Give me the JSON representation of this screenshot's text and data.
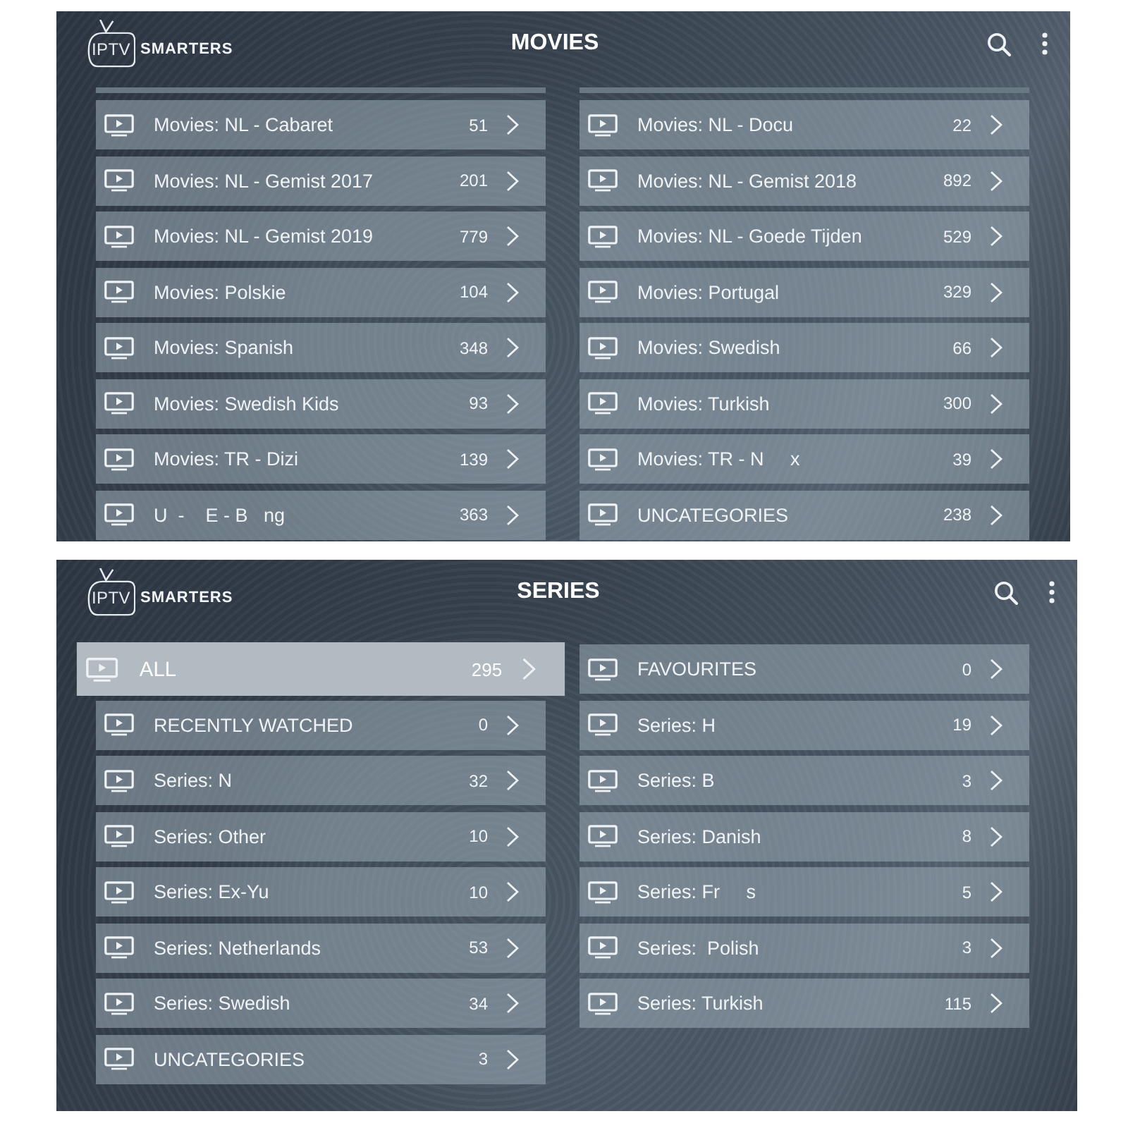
{
  "screens": [
    {
      "logo": {
        "boxed": "IPTV",
        "name": "SMARTERS"
      },
      "title": "MOVIES",
      "scrolled": true,
      "columns": [
        {
          "rows": [
            {
              "label": "Movies: NL - Cabaret",
              "count": "51",
              "selected": false
            },
            {
              "label": "Movies: NL - Gemist 2017",
              "count": "201",
              "selected": false
            },
            {
              "label": "Movies: NL - Gemist 2019",
              "count": "779",
              "selected": false
            },
            {
              "label": "Movies: Polskie",
              "count": "104",
              "selected": false
            },
            {
              "label": "Movies: Spanish",
              "count": "348",
              "selected": false
            },
            {
              "label": "Movies: Swedish Kids",
              "count": "93",
              "selected": false
            },
            {
              "label": "Movies: TR - Dizi",
              "count": "139",
              "selected": false
            },
            {
              "label": "U  -    E - B   ng",
              "count": "363",
              "selected": false
            }
          ]
        },
        {
          "rows": [
            {
              "label": "Movies: NL - Docu",
              "count": "22",
              "selected": false
            },
            {
              "label": "Movies: NL - Gemist 2018",
              "count": "892",
              "selected": false
            },
            {
              "label": "Movies: NL - Goede Tijden",
              "count": "529",
              "selected": false
            },
            {
              "label": "Movies: Portugal",
              "count": "329",
              "selected": false
            },
            {
              "label": "Movies: Swedish",
              "count": "66",
              "selected": false
            },
            {
              "label": "Movies: Turkish",
              "count": "300",
              "selected": false
            },
            {
              "label": "Movies: TR - N     x",
              "count": "39",
              "selected": false
            },
            {
              "label": "UNCATEGORIES",
              "count": "238",
              "selected": false
            }
          ]
        }
      ]
    },
    {
      "logo": {
        "boxed": "IPTV",
        "name": "SMARTERS"
      },
      "title": "SERIES",
      "scrolled": false,
      "columns": [
        {
          "rows": [
            {
              "label": "ALL",
              "count": "295",
              "selected": true
            },
            {
              "label": "RECENTLY WATCHED",
              "count": "0",
              "selected": false
            },
            {
              "label": "Series: N",
              "count": "32",
              "selected": false
            },
            {
              "label": "Series: Other",
              "count": "10",
              "selected": false
            },
            {
              "label": "Series: Ex-Yu",
              "count": "10",
              "selected": false
            },
            {
              "label": "Series: Netherlands",
              "count": "53",
              "selected": false
            },
            {
              "label": "Series: Swedish",
              "count": "34",
              "selected": false
            },
            {
              "label": "UNCATEGORIES",
              "count": "3",
              "selected": false
            }
          ]
        },
        {
          "rows": [
            {
              "label": "FAVOURITES",
              "count": "0",
              "selected": false
            },
            {
              "label": "Series: H",
              "count": "19",
              "selected": false
            },
            {
              "label": "Series: B",
              "count": "3",
              "selected": false
            },
            {
              "label": "Series: Danish",
              "count": "8",
              "selected": false
            },
            {
              "label": "Series: Fr     s",
              "count": "5",
              "selected": false
            },
            {
              "label": "Series:  Polish",
              "count": "3",
              "selected": false
            },
            {
              "label": "Series: Turkish",
              "count": "115",
              "selected": false
            }
          ]
        }
      ]
    }
  ]
}
